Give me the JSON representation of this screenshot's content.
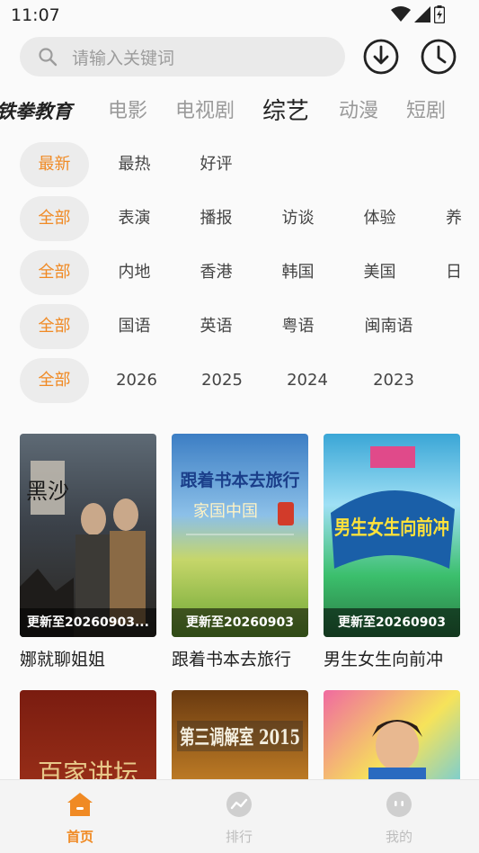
{
  "status_bar": {
    "time": "11:07"
  },
  "search": {
    "placeholder": "请输入关键词"
  },
  "categories": [
    "铁拳教育",
    "电影",
    "电视剧",
    "综艺",
    "动漫",
    "短剧"
  ],
  "filters": {
    "sort": [
      "最新",
      "最热",
      "好评"
    ],
    "genre": [
      "全部",
      "表演",
      "播报",
      "访谈",
      "体验",
      "养"
    ],
    "region": [
      "全部",
      "内地",
      "香港",
      "韩国",
      "美国",
      "日"
    ],
    "language": [
      "全部",
      "国语",
      "英语",
      "粤语",
      "闽南语"
    ],
    "year": [
      "全部",
      "2026",
      "2025",
      "2024",
      "2023"
    ]
  },
  "items": [
    {
      "title": "娜就聊姐姐",
      "update": "更新至20260903...",
      "poster_text": "黑沙"
    },
    {
      "title": "跟着书本去旅行",
      "update": "更新至20260903",
      "poster_text": "跟着书本去旅行"
    },
    {
      "title": "男生女生向前冲",
      "update": "更新至20260903",
      "poster_text": "男生女生向前冲"
    },
    {
      "title": "",
      "update": "",
      "poster_text": "百家讲坛"
    },
    {
      "title": "",
      "update": "",
      "poster_text": "第三调解室 2015"
    },
    {
      "title": "",
      "update": "",
      "poster_text": ""
    }
  ],
  "bottom_nav": [
    "首页",
    "排行",
    "我的"
  ],
  "colors": {
    "accent": "#f08a24",
    "chip_bg": "#ececec",
    "search_bg": "#eaeaea"
  }
}
